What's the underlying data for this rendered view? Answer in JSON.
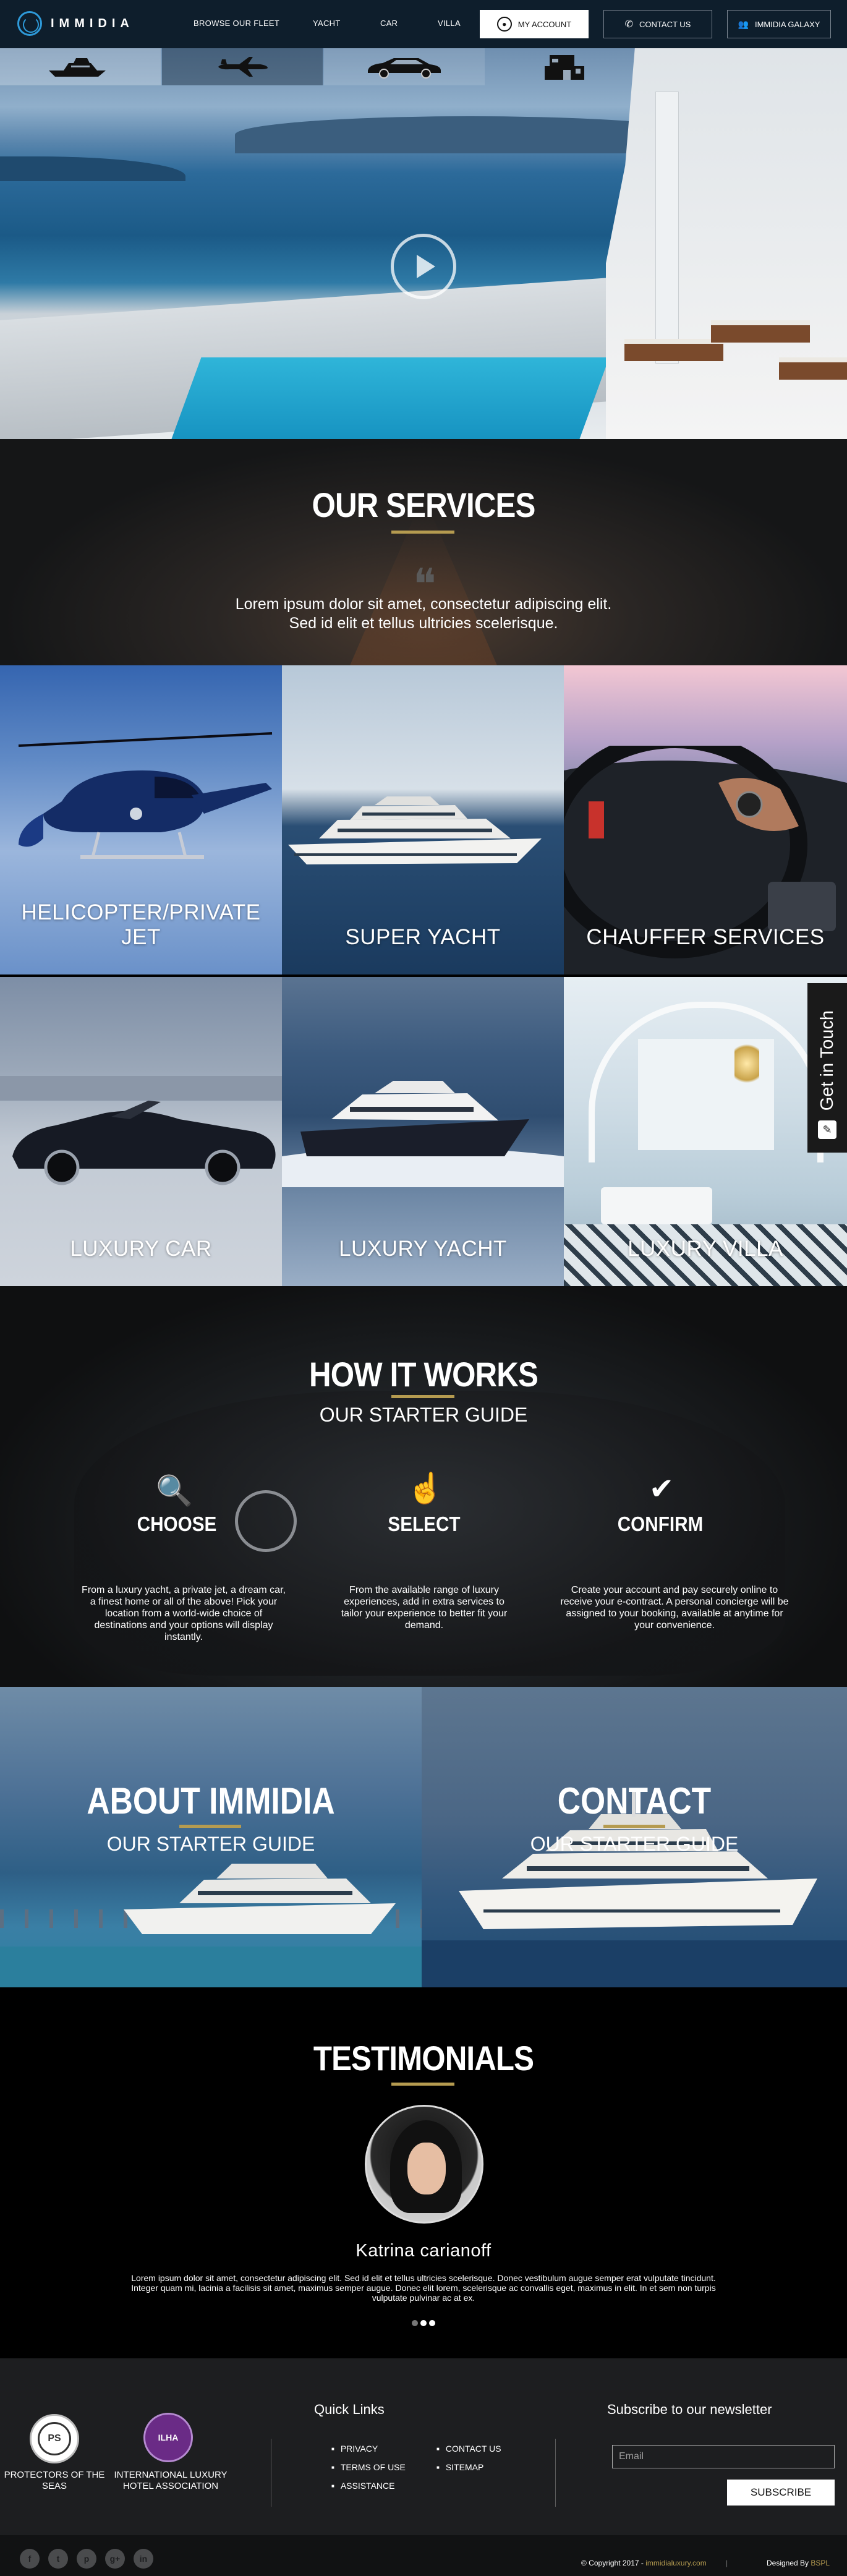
{
  "header": {
    "brand": "IMMIDIA",
    "nav": [
      "BROWSE OUR FLEET",
      "YACHT",
      "CAR",
      "VILLA"
    ],
    "account_label": "MY ACCOUNT",
    "contact_label": "CONTACT US",
    "galaxy_label": "IMMIDIA GALAXY"
  },
  "fleet_tabs": [
    "yacht-icon",
    "jet-icon",
    "car-icon",
    "villa-icon"
  ],
  "services": {
    "title": "OUR SERVICES",
    "quote": "Lorem ipsum dolor sit amet, consectetur adipiscing elit.",
    "quote2": "Sed id elit et tellus ultricies scelerisque.",
    "tiles": [
      "HELICOPTER/PRIVATE JET",
      "SUPER YACHT",
      "CHAUFFER SERVICES",
      "LUXURY CAR",
      "LUXURY YACHT",
      "LUXURY VILLA"
    ]
  },
  "get_in_touch": "Get in Touch",
  "how": {
    "title": "HOW IT WORKS",
    "subtitle": "OUR STARTER GUIDE",
    "steps": [
      {
        "title": "CHOOSE",
        "text": "From a luxury yacht, a private jet, a dream car, a finest home or all of the above! Pick your location from a world-wide choice of destinations and your options will display instantly."
      },
      {
        "title": "SELECT",
        "text": "From the available range of luxury experiences, add in extra services to tailor your experience to better fit your demand."
      },
      {
        "title": "CONFIRM",
        "text": "Create your account and pay securely online to receive your e-contract. A personal concierge will be assigned to your booking, available at anytime for your convenience."
      }
    ]
  },
  "about": {
    "title": "ABOUT IMMIDIA",
    "subtitle": "OUR STARTER GUIDE"
  },
  "contact": {
    "title": "CONTACT",
    "subtitle": "OUR STARTER GUIDE"
  },
  "testimonials": {
    "title": "TESTIMONIALS",
    "name": "Katrina carianoff",
    "text": "Lorem ipsum dolor sit amet, consectetur adipiscing elit. Sed id elit et tellus ultricies scelerisque. Donec vestibulum augue semper erat vulputate tincidunt. Integer quam mi, lacinia a facilisis sit amet, maximus semper augue. Donec elit lorem, scelerisque ac convallis eget, maximus in elit. In et sem non turpis vulputate pulvinar ac at ex.",
    "active_dot": 0,
    "dots": 3
  },
  "footer": {
    "badge1": "PROTECTORS OF THE SEAS",
    "badge1_mark": "PS",
    "badge2": "INTERNATIONAL LUXURY HOTEL ASSOCIATION",
    "badge2_mark": "ILHA",
    "quick_links_title": "Quick Links",
    "links_col1": [
      "PRIVACY",
      "TERMS OF USE",
      "ASSISTANCE"
    ],
    "links_col2": [
      "CONTACT US",
      "SITEMAP"
    ],
    "newsletter_title": "Subscribe to our newsletter",
    "email_placeholder": "Email",
    "subscribe_label": "SUBSCRIBE",
    "social": [
      "f",
      "t",
      "p",
      "g+",
      "in"
    ],
    "copyright": "© Copyright 2017 - ",
    "copyright_site": "immidialuxury.com",
    "designed_by": "Designed By ",
    "designer": "BSPL"
  },
  "colors": {
    "accent": "#b59b50",
    "header_bg": "#0e1e2c",
    "logo_blue": "#2e9ad9"
  }
}
